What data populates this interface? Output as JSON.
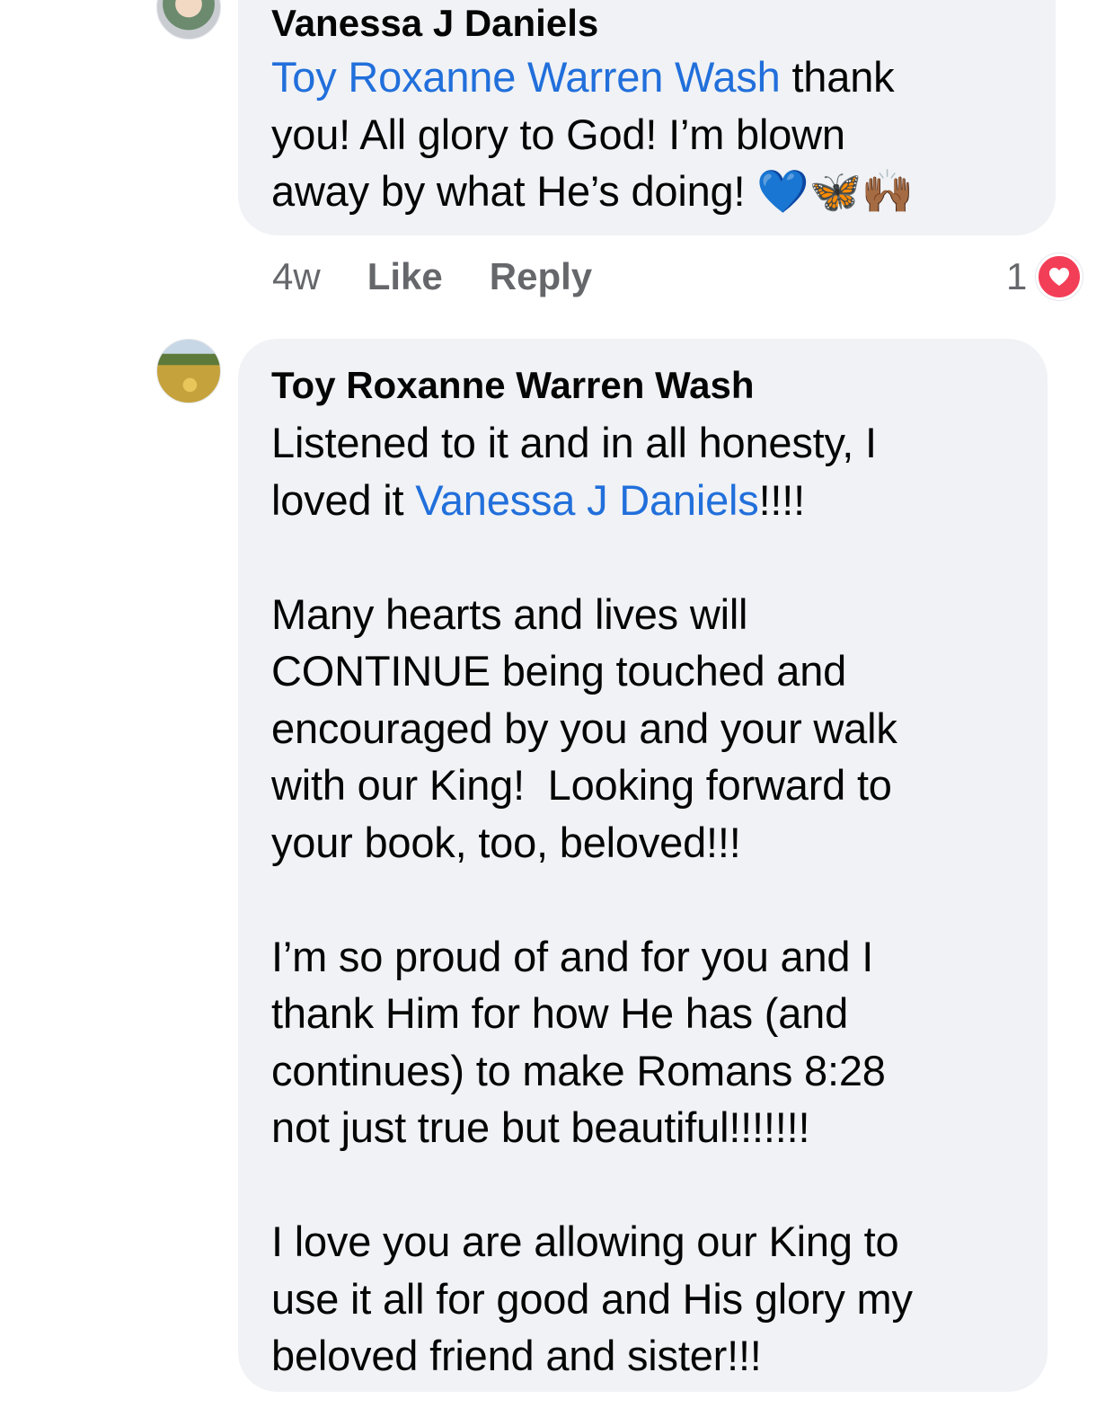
{
  "comments": [
    {
      "author": "Vanessa J Daniels",
      "mention": "Toy Roxanne Warren Wash",
      "text": " thank\nyou! All glory to God! I’m blown\naway by what He’s doing! ",
      "emojis": "💙🦋🙌🏾",
      "timestamp": "4w",
      "like_label": "Like",
      "reply_label": "Reply",
      "reaction_count": "1",
      "reaction_icon": "love-icon",
      "reaction_color": "#f33e58"
    },
    {
      "author": "Toy Roxanne Warren Wash",
      "text_before": "Listened to it and in all honesty, I\nloved it ",
      "mention": "Vanessa J Daniels",
      "text_after": "!!!!\n\nMany hearts and lives will\nCONTINUE being touched and\nencouraged by you and your walk\nwith our King!  Looking forward to\nyour book, too, beloved!!!\n\nI’m so proud of and for you and I\nthank Him for how He has (and\ncontinues) to make Romans 8:28\nnot just true but beautiful!!!!!!!\n\nI love you are allowing our King to\nuse it all for good and His glory my\nbeloved friend and sister!!!"
    }
  ],
  "colors": {
    "mention": "#216fdb",
    "bubble": "#f0f2f5",
    "meta_text": "#65676b"
  }
}
